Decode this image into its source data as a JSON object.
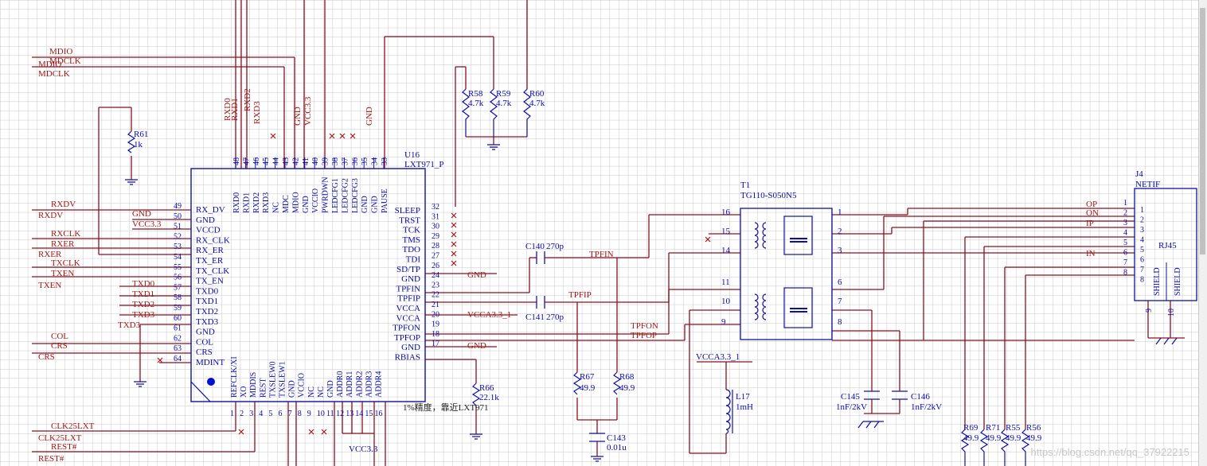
{
  "u16": {
    "ref": "U16",
    "part": "LXT971_P",
    "top_pins": [
      "RXD0",
      "RXD1",
      "RXD2",
      "RXD3",
      "NC",
      "MDC",
      "MDIO",
      "GND",
      "VCCIO",
      "PWRDWN",
      "LEDCFG1",
      "LEDCFG2",
      "LEDCFG3",
      "GND",
      "GND",
      "PAUSE"
    ],
    "top_nums": [
      "48",
      "47",
      "46",
      "45",
      "44",
      "43",
      "42",
      "41",
      "40",
      "39",
      "38",
      "37",
      "36",
      "35",
      "34",
      "33"
    ],
    "left_pins": [
      "RX_DV",
      "GND",
      "VCCD",
      "RX_CLK",
      "RX_ER",
      "TX_ER",
      "TX_CLK",
      "TX_EN",
      "TXD0",
      "TXD1",
      "TXD2",
      "TXD3",
      "GND",
      "COL",
      "CRS",
      "MDINT"
    ],
    "left_nums": [
      "49",
      "50",
      "51",
      "52",
      "53",
      "54",
      "55",
      "56",
      "57",
      "58",
      "59",
      "60",
      "61",
      "62",
      "63",
      "64"
    ],
    "right_pins": [
      "SLEEP",
      "TRST",
      "TCK",
      "TMS",
      "TDO",
      "TDI",
      "SD/TP",
      "GND",
      "TPFIN",
      "TPFIP",
      "VCCA",
      "VCCA",
      "TPFON",
      "TPFOP",
      "GND",
      "RBIAS"
    ],
    "right_nums": [
      "32",
      "31",
      "30",
      "29",
      "28",
      "27",
      "26",
      "24",
      "23",
      "22",
      "21",
      "20",
      "19",
      "18",
      "17"
    ],
    "bottom_pins": [
      "REFCLK/XI",
      "XO",
      "MDDIS",
      "REST",
      "TXSLEW0",
      "TXSLEW1",
      "GND",
      "VCCIO",
      "NC",
      "NC",
      "GND",
      "ADDR0",
      "ADDR1",
      "ADDR2",
      "ADDR3",
      "ADDR4"
    ],
    "bottom_nums": [
      "1",
      "2",
      "3",
      "4",
      "5",
      "6",
      "7",
      "8",
      "9",
      "10",
      "11",
      "12",
      "13",
      "14",
      "15",
      "16"
    ]
  },
  "nets": {
    "mdio": "MDIO",
    "mdclk": "MDCLK",
    "rxdv": "RXDV",
    "rxclk": "RXCLK",
    "rxer": "RXER",
    "txclk": "TXCLK",
    "txen": "TXEN",
    "txd0": "TXD0",
    "txd1": "TXD1",
    "txd2": "TXD2",
    "txd3": "TXD3",
    "col": "COL",
    "crs": "CRS",
    "clk25": "CLK25LXT",
    "rest": "REST#",
    "gnd": "GND",
    "vcc33": "VCC3.3",
    "vcca": "VCCA3.3_1",
    "tpfin": "TPFIN",
    "tpfip": "TPFIP",
    "tpfon": "TPFON",
    "tpfop": "TPFOP",
    "rxd0": "RXD0",
    "rxd1": "RXD1",
    "rxd2": "RXD2",
    "rxd3": "RXD3",
    "vcc33b": "VCC3.3",
    "vcca_b": "VCCA3.3_1",
    "op": "OP",
    "on": "ON",
    "ip": "IP",
    "in": "IN"
  },
  "resistors": {
    "r58": {
      "ref": "R58",
      "val": "4.7k"
    },
    "r59": {
      "ref": "R59",
      "val": "4.7k"
    },
    "r60": {
      "ref": "R60",
      "val": "4.7k"
    },
    "r61": {
      "ref": "R61",
      "val": "1k"
    },
    "r66": {
      "ref": "R66",
      "val": "22.1k"
    },
    "r67": {
      "ref": "R67",
      "val": "49.9"
    },
    "r68": {
      "ref": "R68",
      "val": "49.9"
    },
    "r69": {
      "ref": "R69",
      "val": "49.9"
    },
    "r71": {
      "ref": "R71",
      "val": "49.9"
    },
    "r55": {
      "ref": "R55",
      "val": "49.9"
    },
    "r56": {
      "ref": "R56",
      "val": "49.9"
    }
  },
  "caps": {
    "c140": {
      "ref": "C140",
      "val": "270p"
    },
    "c141": {
      "ref": "C141",
      "val": "270p"
    },
    "c143": {
      "ref": "C143",
      "val": "0.01u"
    },
    "c145": {
      "ref": "C145",
      "val": "1nF/2kV"
    },
    "c146": {
      "ref": "C146",
      "val": "1nF/2kV"
    }
  },
  "l17": {
    "ref": "L17",
    "val": "1mH"
  },
  "t1": {
    "ref": "T1",
    "part": "TG110-S050N5",
    "left_nums": [
      "16",
      "15",
      "14",
      "11",
      "10",
      "9"
    ],
    "right_nums": [
      "1",
      "2",
      "3",
      "6",
      "7",
      "8"
    ]
  },
  "j4": {
    "ref": "J4",
    "part": "NETIF",
    "label": "RJ45",
    "pins": [
      "1",
      "2",
      "3",
      "4",
      "5",
      "6",
      "7",
      "8"
    ],
    "shield1": "SHIELD",
    "shield2": "SHIELD",
    "gnd_pins": [
      "9",
      "10"
    ]
  },
  "note": "1%精度，靠近LXT971",
  "watermark": "https://blog.csdn.net/qq_37922215",
  "colors": {
    "wire": "#8a1020",
    "component": "#1010a0",
    "grid": "#c8c8c8",
    "background": "#ffffff"
  }
}
